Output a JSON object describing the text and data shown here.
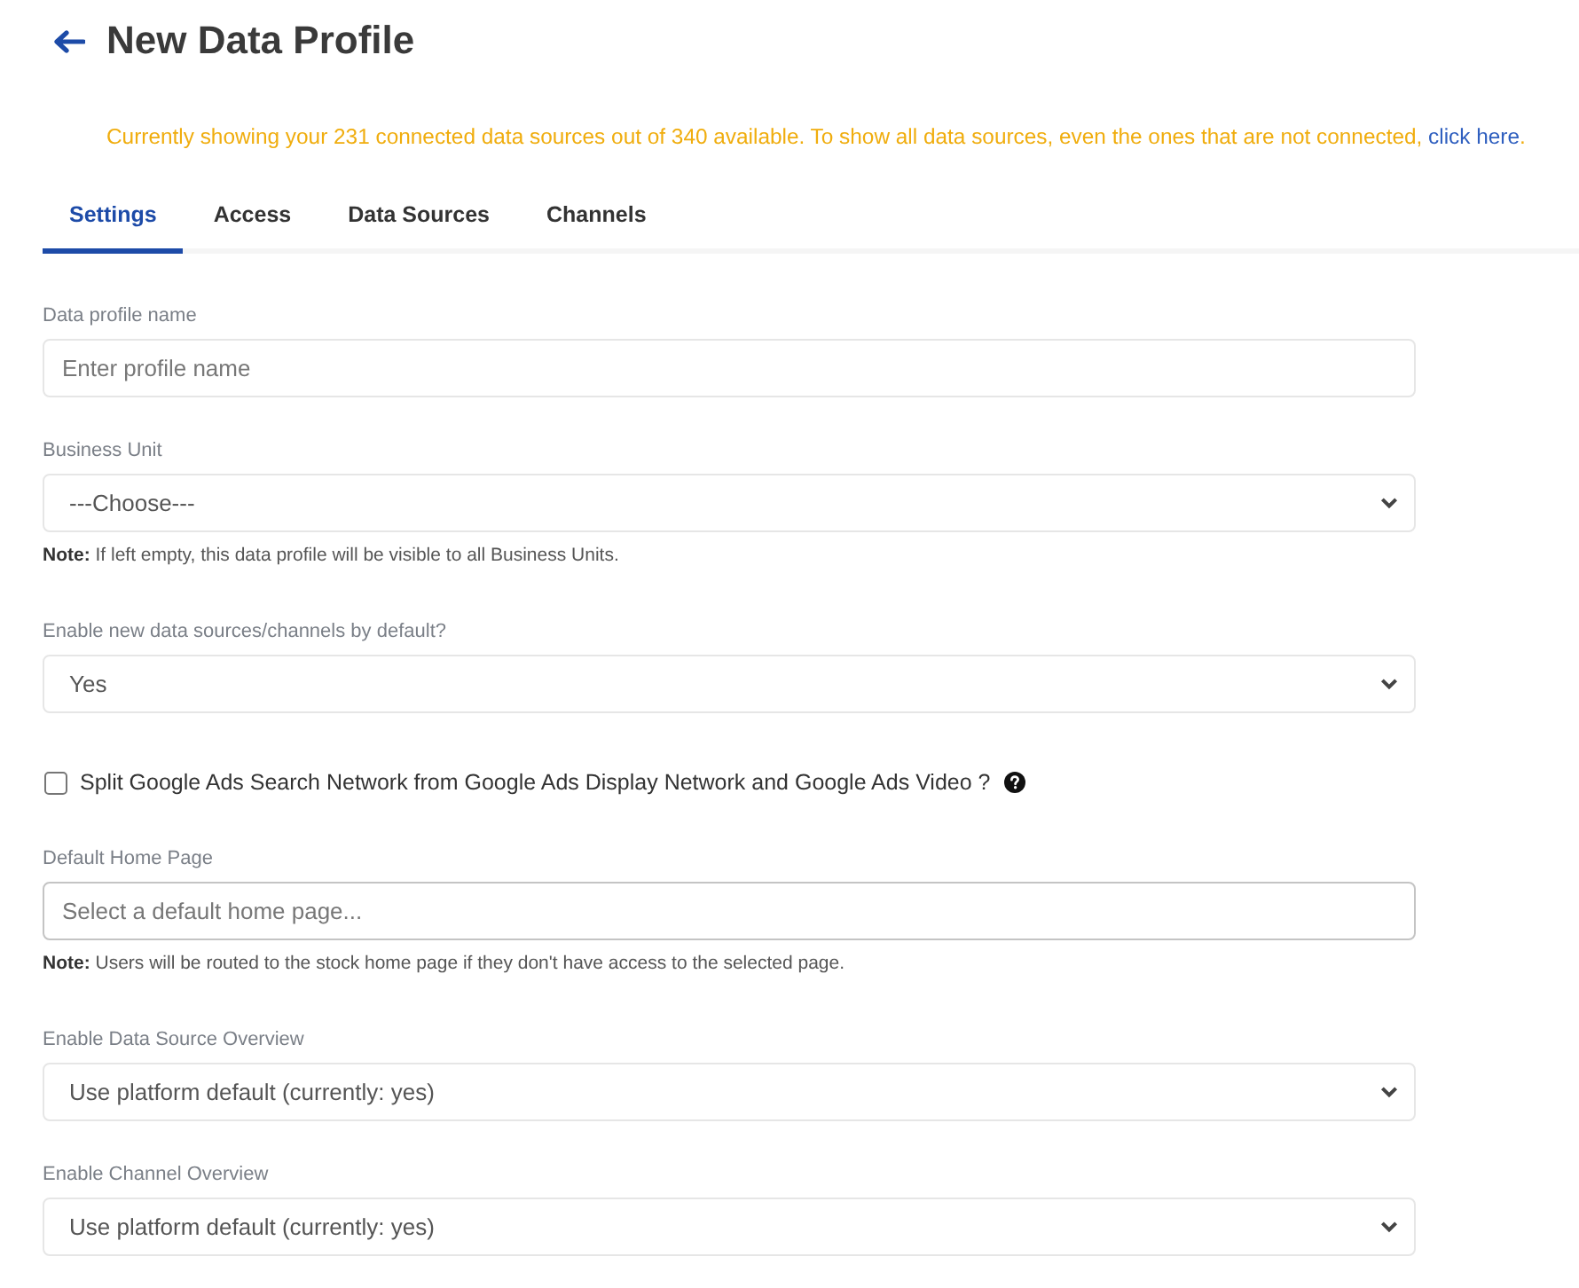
{
  "header": {
    "title": "New Data Profile"
  },
  "notice": {
    "text": "Currently showing your 231 connected data sources out of 340 available. To show all data sources, even the ones that are not connected,",
    "link": "click here",
    "end": "."
  },
  "tabs": [
    {
      "label": "Settings",
      "selected": true
    },
    {
      "label": "Access",
      "selected": false
    },
    {
      "label": "Data Sources",
      "selected": false
    },
    {
      "label": "Channels",
      "selected": false
    }
  ],
  "form": {
    "fields": [
      {
        "kind": "text",
        "label": "Data profile name",
        "placeholder": "Enter profile name"
      },
      {
        "kind": "select",
        "label": "Business Unit",
        "value": "---Choose---",
        "note": "**Note:** If left empty, this data profile will be visible to all Business Units."
      },
      {
        "kind": "select",
        "label": "Enable new data sources/channels by default?",
        "value": "Yes"
      },
      {
        "kind": "checkbox",
        "label": "Split Google Ads Search Network from Google Ads Display Network and Google Ads Video ?",
        "checked": false
      },
      {
        "kind": "search",
        "label": "Default Home Page",
        "placeholder": "Select a default home page...",
        "note": "**Note:** Users will be routed to the stock home page if they don't have access to the selected page."
      },
      {
        "kind": "select",
        "label": "Enable Data Source Overview",
        "value": "Use platform default (currently: yes)"
      },
      {
        "kind": "select",
        "label": "Enable Channel Overview",
        "value": "Use platform default (currently: yes)"
      }
    ]
  }
}
